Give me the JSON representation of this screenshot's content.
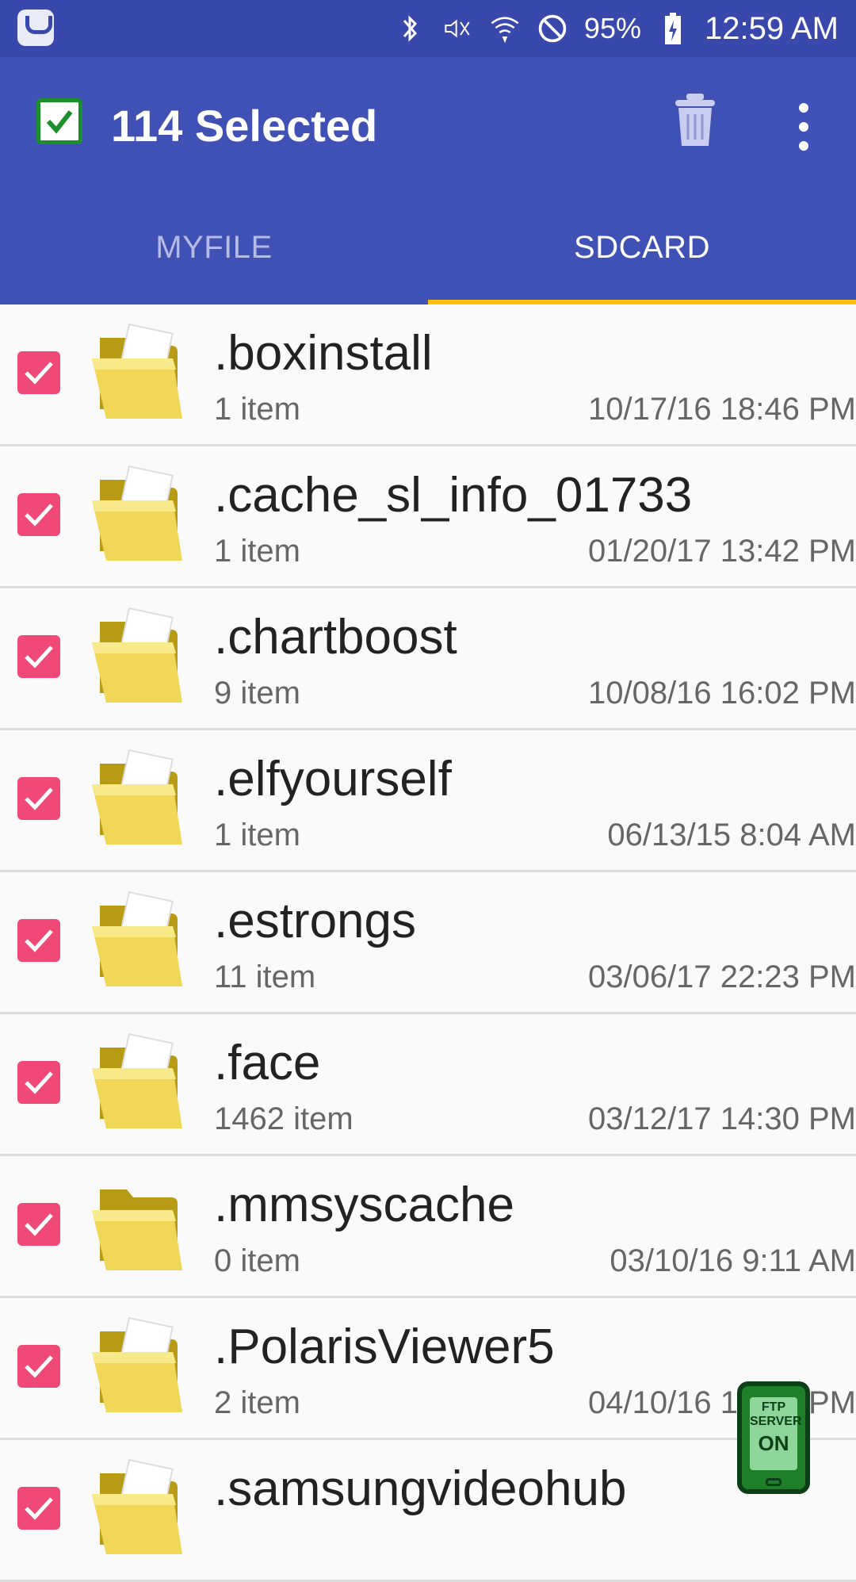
{
  "status_bar": {
    "app_icon": "galaxy-icon",
    "icons": [
      "bluetooth-icon",
      "mute-icon",
      "wifi-icon",
      "dnd-icon"
    ],
    "battery_percent": "95%",
    "time": "12:59 AM"
  },
  "toolbar": {
    "selected_text": "114 Selected",
    "delete_icon": "trash-icon",
    "more_icon": "more-vert-icon"
  },
  "tabs": [
    {
      "label": "MYFILE",
      "active": false
    },
    {
      "label": "SDCARD",
      "active": true
    }
  ],
  "items": [
    {
      "name": ".boxinstall",
      "count": "1 item",
      "date": "10/17/16 18:46 PM"
    },
    {
      "name": ".cache_sl_info_01733",
      "count": "1 item",
      "date": "01/20/17 13:42 PM"
    },
    {
      "name": ".chartboost",
      "count": "9 item",
      "date": "10/08/16 16:02 PM"
    },
    {
      "name": ".elfyourself",
      "count": "1 item",
      "date": "06/13/15 8:04 AM"
    },
    {
      "name": ".estrongs",
      "count": "11 item",
      "date": "03/06/17 22:23 PM"
    },
    {
      "name": ".face",
      "count": "1462 item",
      "date": "03/12/17 14:30 PM"
    },
    {
      "name": ".mmsyscache",
      "count": "0 item",
      "date": "03/10/16 9:11 AM"
    },
    {
      "name": ".PolarisViewer5",
      "count": "2 item",
      "date": "04/10/16 14:21 PM"
    },
    {
      "name": ".samsungvideohub",
      "count": "",
      "date": ""
    }
  ],
  "ftp_badge": {
    "line1": "FTP",
    "line2": "SERVER",
    "line3": "ON"
  },
  "colors": {
    "app_bar": "#3f51b5",
    "status_bar": "#3948ab",
    "tab_indicator": "#ffc107",
    "checkbox": "#f04978"
  }
}
